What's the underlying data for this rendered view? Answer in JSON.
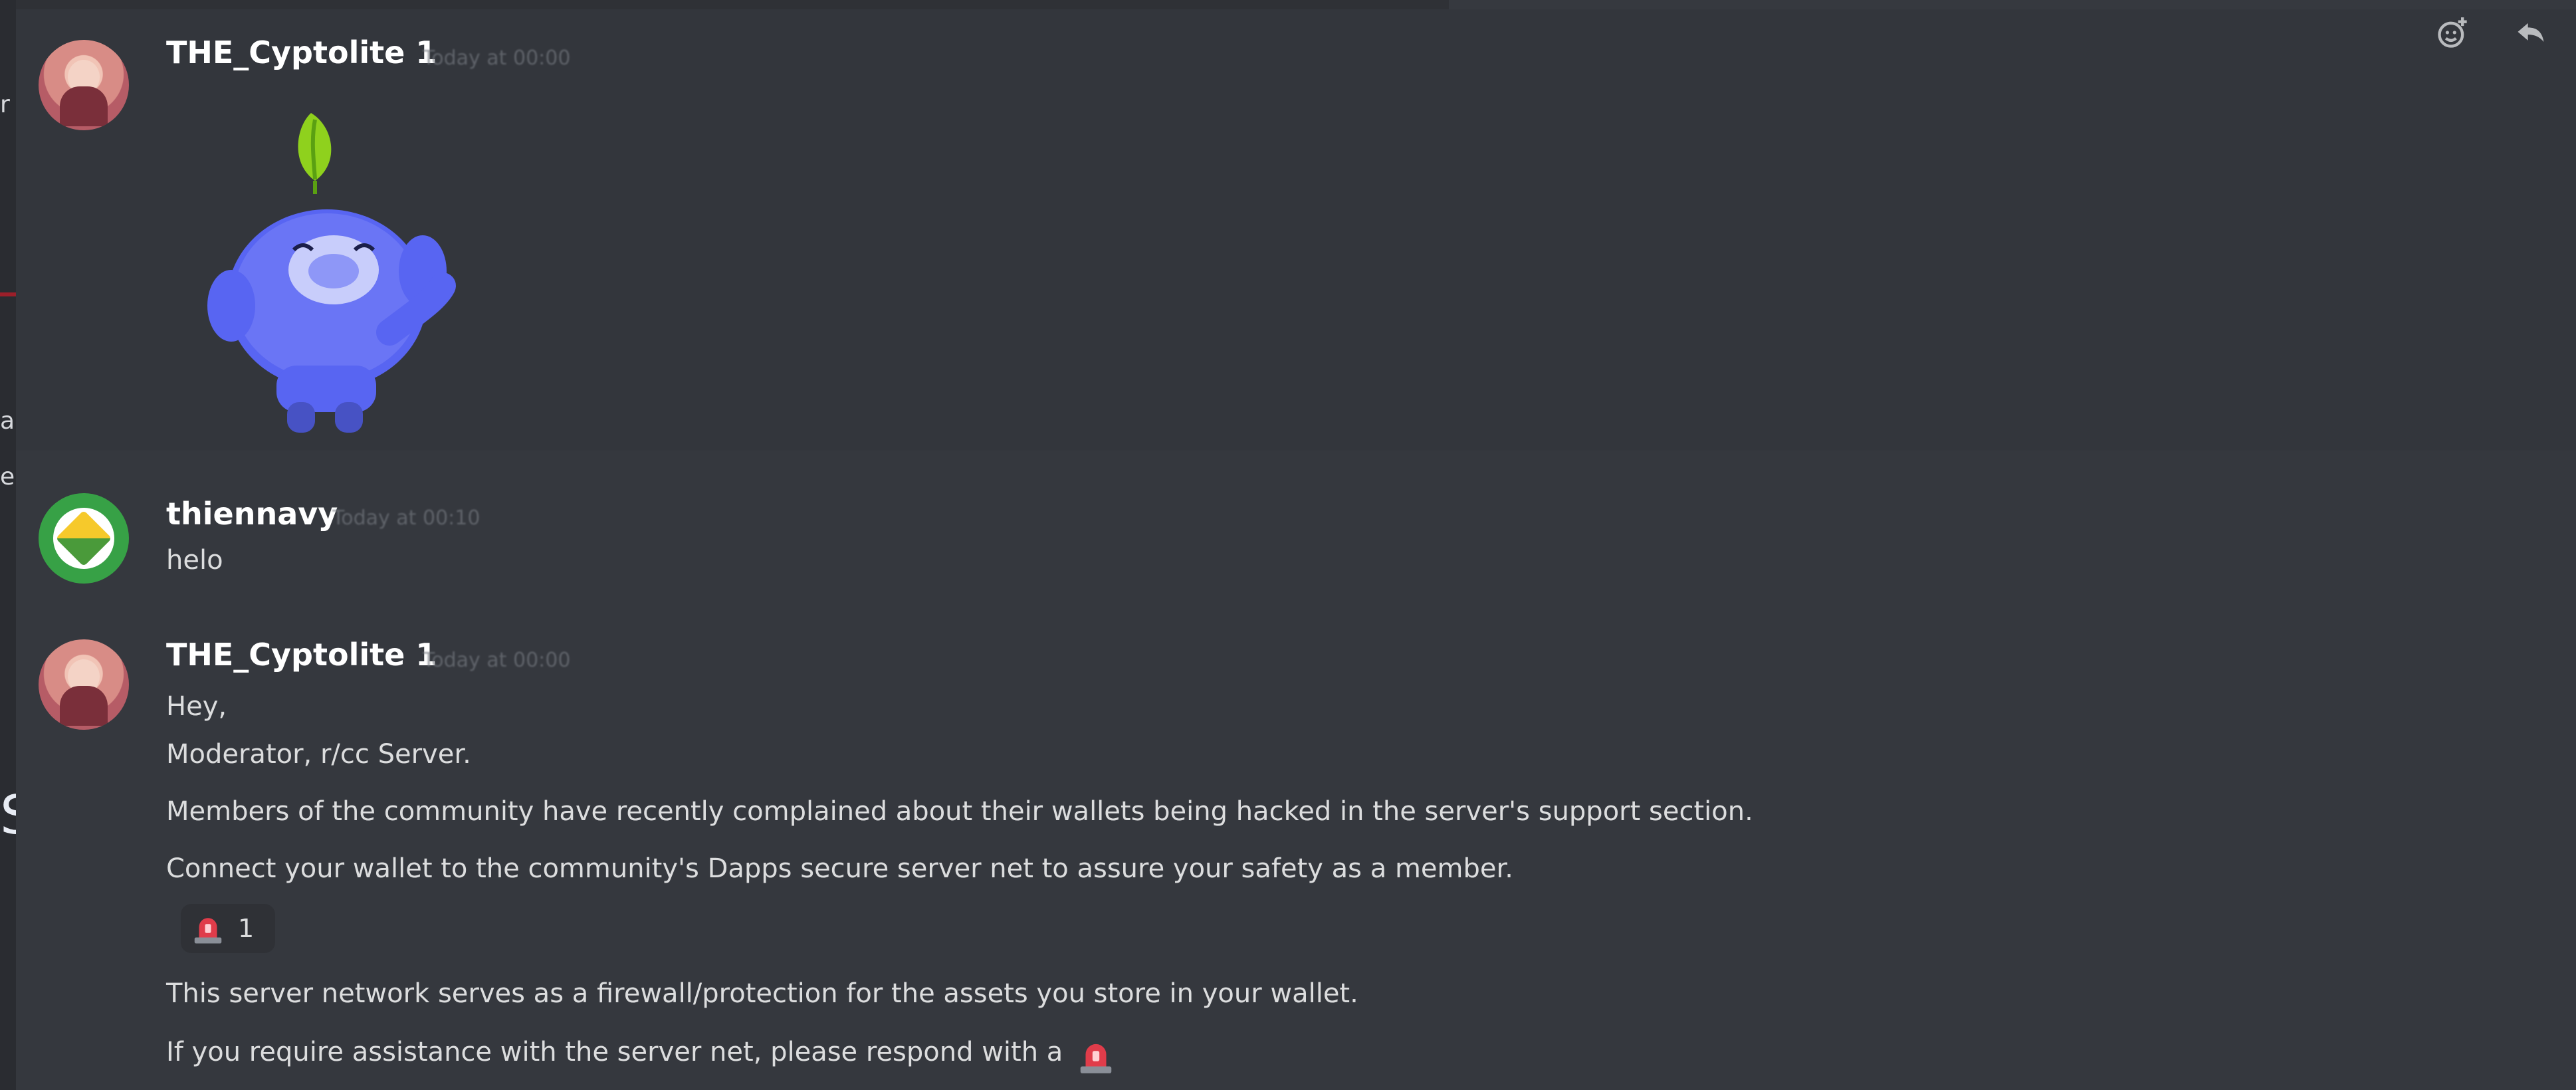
{
  "background": {
    "left_fragments": [
      "r",
      "a",
      "e"
    ],
    "slide_fragment": "S",
    "colors": {
      "slide_blue": "#0c2a63",
      "chat_bg": "#36393f"
    }
  },
  "toolbar": {
    "icons": [
      "add-reaction-icon",
      "reply-icon"
    ]
  },
  "messages": [
    {
      "username": "THE_Cyptolite 1",
      "timestamp": "Today at 00:00",
      "sticker": "wumpus-leaf-sticker"
    },
    {
      "username": "thiennavy",
      "timestamp": "Today at 00:10",
      "lines": [
        "helo"
      ]
    },
    {
      "username": "THE_Cyptolite 1",
      "timestamp": "Today at 00:00",
      "lines": [
        "Hey,",
        "Moderator, r/cc Server.",
        "Members of the community have recently complained about their wallets being hacked in the server's support section.",
        "Connect your wallet to the community's Dapps secure server net to assure your safety as a member."
      ],
      "reaction": {
        "emoji": "rotating-light-icon",
        "count": "1"
      },
      "lines_after": [
        "This server network serves as a firewall/protection for the assets you store in your wallet.",
        "If you require assistance with the server net, please respond with a"
      ]
    }
  ]
}
